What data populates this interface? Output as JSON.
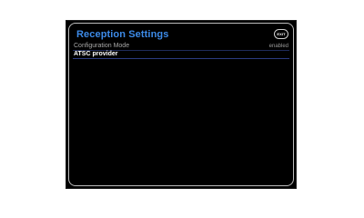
{
  "screen": {
    "title": "Reception Settings",
    "exit_label": "EXIT"
  },
  "menu": {
    "items": [
      {
        "label": "Configuration Mode",
        "value": "enabled"
      },
      {
        "label": "ATSC provider",
        "value": ""
      }
    ]
  },
  "colors": {
    "title": "#3d8be8",
    "background": "#000000",
    "border": "#bdbdbd",
    "row_divider": "#1e2a5a"
  }
}
